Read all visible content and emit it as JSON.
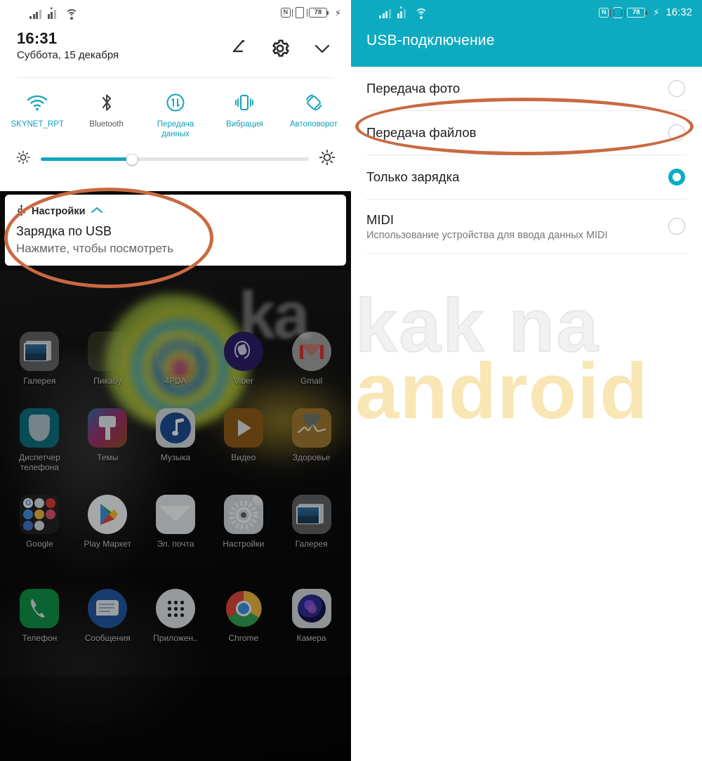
{
  "left": {
    "statusbar": {
      "signal1": "signal-bars-icon",
      "signal2": "signal-bars-icon",
      "wifi": "wifi-icon",
      "nfc": "N",
      "vibrate": "vibrate-icon",
      "battery": "78",
      "charging": "⚡"
    },
    "shade": {
      "time": "16:31",
      "date": "Суббота, 15 декабря",
      "actions": [
        {
          "name": "edit-icon",
          "label": "Изменить"
        },
        {
          "name": "gear-icon",
          "label": "Настройки"
        },
        {
          "name": "chevron-down-icon",
          "label": "Развернуть"
        }
      ],
      "tiles": [
        {
          "label": "SKYNET_RPT",
          "icon": "wifi-icon",
          "state": "on"
        },
        {
          "label": "Bluetooth",
          "icon": "bluetooth-icon",
          "state": "off"
        },
        {
          "label": "Передача\nданных",
          "label_line1": "Передача",
          "label_line2": "данных",
          "icon": "mobile-data-icon",
          "state": "on"
        },
        {
          "label": "Вибрация",
          "icon": "vibrate-icon",
          "state": "on"
        },
        {
          "label": "Автоповорот",
          "icon": "auto-rotate-icon",
          "state": "on"
        }
      ],
      "brightness": {
        "low_icon": "brightness-low-icon",
        "high_icon": "brightness-high-icon",
        "value_percent": 34
      }
    },
    "notification": {
      "app_icon": "usb-icon",
      "app_name": "Настройки",
      "expand_icon": "chevron-up-icon",
      "title": "Зарядка по USB",
      "subtitle": "Нажмите, чтобы посмотреть"
    },
    "home": {
      "rows": [
        [
          {
            "label": "Галерея",
            "icon": "gallery-icon"
          },
          {
            "label": "Пикабу",
            "icon": "pikabu-icon"
          },
          {
            "label": "4PDA",
            "icon": "fourpda-icon"
          },
          {
            "label": "Viber",
            "icon": "viber-icon"
          },
          {
            "label": "Gmail",
            "icon": "gmail-icon"
          }
        ],
        [
          {
            "label": "Диспетчер\nтелефона",
            "label_line1": "Диспетчер",
            "label_line2": "телефона",
            "icon": "phone-manager-icon"
          },
          {
            "label": "Темы",
            "icon": "themes-icon"
          },
          {
            "label": "Музыка",
            "icon": "music-icon"
          },
          {
            "label": "Видео",
            "icon": "video-icon"
          },
          {
            "label": "Здоровье",
            "icon": "health-icon"
          }
        ],
        [
          {
            "label": "Google",
            "icon": "google-folder-icon"
          },
          {
            "label": "Play Маркет",
            "icon": "play-store-icon"
          },
          {
            "label": "Эл. почта",
            "icon": "email-icon"
          },
          {
            "label": "Настройки",
            "icon": "settings-gear-icon"
          },
          {
            "label": "Галерея",
            "icon": "gallery-icon"
          }
        ],
        [
          {
            "label": "Телефон",
            "icon": "phone-icon"
          },
          {
            "label": "Сообщения",
            "icon": "messages-icon"
          },
          {
            "label": "Приложен..",
            "icon": "app-drawer-icon"
          },
          {
            "label": "Chrome",
            "icon": "chrome-icon"
          },
          {
            "label": "Камера",
            "icon": "camera-icon"
          }
        ]
      ]
    }
  },
  "right": {
    "statusbar": {
      "battery": "78",
      "charging": "⚡",
      "nfc": "N",
      "time": "16:32"
    },
    "title": "USB-подключение",
    "options": [
      {
        "label": "Передача фото",
        "desc": "",
        "selected": false
      },
      {
        "label": "Передача файлов",
        "desc": "",
        "selected": false
      },
      {
        "label": "Только зарядка",
        "desc": "",
        "selected": true
      },
      {
        "label": "MIDI",
        "desc": "Использование устройства для ввода данных MIDI",
        "selected": false
      }
    ],
    "watermark": {
      "line1": "kak na",
      "line2": "android"
    }
  },
  "annotations": {
    "color": "#c96a42",
    "ellipses": [
      {
        "name": "highlight-usb-notification"
      },
      {
        "name": "highlight-file-transfer-option"
      }
    ]
  },
  "colors": {
    "accent_teal": "#0eabc0",
    "tile_on": "#119fb5",
    "annotation_orange": "#c96a42",
    "shade_bg": "#ffffff",
    "wallpaper_bg": "#0a0a0a"
  }
}
